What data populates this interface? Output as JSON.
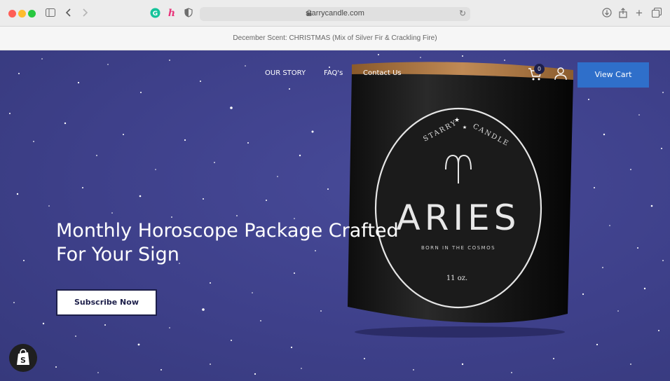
{
  "browser": {
    "url": "starrycandle.com",
    "icons": [
      "sidebar-icon",
      "back-icon",
      "forward-icon",
      "grammarly-icon",
      "honey-icon",
      "shield-icon",
      "lock-icon",
      "reload-icon",
      "download-icon",
      "share-icon",
      "new-tab-icon",
      "tabs-icon"
    ]
  },
  "announcement": {
    "text": "December Scent: CHRISTMAS (Mix of Silver Fir & Crackling Fire)"
  },
  "nav": {
    "items": [
      {
        "label": "OUR STORY"
      },
      {
        "label": "FAQ's"
      },
      {
        "label": "Contact Us"
      }
    ],
    "cart_count": "0",
    "view_cart_label": "View Cart"
  },
  "hero": {
    "headline_line1": "Monthly Horoscope Package Crafted",
    "headline_line2": "For Your Sign",
    "cta_label": "Subscribe Now"
  },
  "product": {
    "brand_left": "STARRY",
    "brand_right": "CANDLE",
    "name": "ARIES",
    "tagline": "BORN IN THE COSMOS",
    "size": "11 oz."
  },
  "colors": {
    "hero_bg": "#3e408a",
    "view_cart_bg": "#2f6fca",
    "text_dark": "#1d1f4a"
  }
}
